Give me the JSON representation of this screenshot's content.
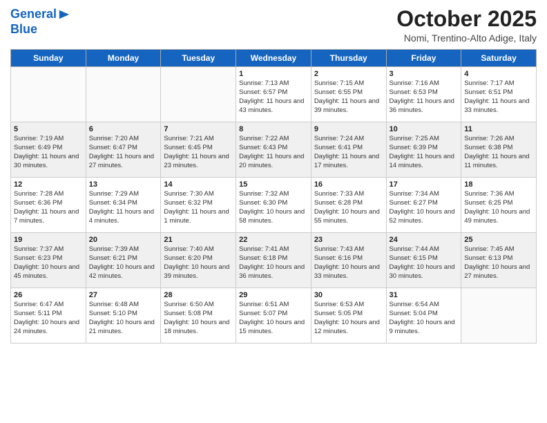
{
  "header": {
    "logo_line1": "General",
    "logo_line2": "Blue",
    "month": "October 2025",
    "location": "Nomi, Trentino-Alto Adige, Italy"
  },
  "days_of_week": [
    "Sunday",
    "Monday",
    "Tuesday",
    "Wednesday",
    "Thursday",
    "Friday",
    "Saturday"
  ],
  "weeks": [
    [
      {
        "day": "",
        "sunrise": "",
        "sunset": "",
        "daylight": ""
      },
      {
        "day": "",
        "sunrise": "",
        "sunset": "",
        "daylight": ""
      },
      {
        "day": "",
        "sunrise": "",
        "sunset": "",
        "daylight": ""
      },
      {
        "day": "1",
        "sunrise": "Sunrise: 7:13 AM",
        "sunset": "Sunset: 6:57 PM",
        "daylight": "Daylight: 11 hours and 43 minutes."
      },
      {
        "day": "2",
        "sunrise": "Sunrise: 7:15 AM",
        "sunset": "Sunset: 6:55 PM",
        "daylight": "Daylight: 11 hours and 39 minutes."
      },
      {
        "day": "3",
        "sunrise": "Sunrise: 7:16 AM",
        "sunset": "Sunset: 6:53 PM",
        "daylight": "Daylight: 11 hours and 36 minutes."
      },
      {
        "day": "4",
        "sunrise": "Sunrise: 7:17 AM",
        "sunset": "Sunset: 6:51 PM",
        "daylight": "Daylight: 11 hours and 33 minutes."
      }
    ],
    [
      {
        "day": "5",
        "sunrise": "Sunrise: 7:19 AM",
        "sunset": "Sunset: 6:49 PM",
        "daylight": "Daylight: 11 hours and 30 minutes."
      },
      {
        "day": "6",
        "sunrise": "Sunrise: 7:20 AM",
        "sunset": "Sunset: 6:47 PM",
        "daylight": "Daylight: 11 hours and 27 minutes."
      },
      {
        "day": "7",
        "sunrise": "Sunrise: 7:21 AM",
        "sunset": "Sunset: 6:45 PM",
        "daylight": "Daylight: 11 hours and 23 minutes."
      },
      {
        "day": "8",
        "sunrise": "Sunrise: 7:22 AM",
        "sunset": "Sunset: 6:43 PM",
        "daylight": "Daylight: 11 hours and 20 minutes."
      },
      {
        "day": "9",
        "sunrise": "Sunrise: 7:24 AM",
        "sunset": "Sunset: 6:41 PM",
        "daylight": "Daylight: 11 hours and 17 minutes."
      },
      {
        "day": "10",
        "sunrise": "Sunrise: 7:25 AM",
        "sunset": "Sunset: 6:39 PM",
        "daylight": "Daylight: 11 hours and 14 minutes."
      },
      {
        "day": "11",
        "sunrise": "Sunrise: 7:26 AM",
        "sunset": "Sunset: 6:38 PM",
        "daylight": "Daylight: 11 hours and 11 minutes."
      }
    ],
    [
      {
        "day": "12",
        "sunrise": "Sunrise: 7:28 AM",
        "sunset": "Sunset: 6:36 PM",
        "daylight": "Daylight: 11 hours and 7 minutes."
      },
      {
        "day": "13",
        "sunrise": "Sunrise: 7:29 AM",
        "sunset": "Sunset: 6:34 PM",
        "daylight": "Daylight: 11 hours and 4 minutes."
      },
      {
        "day": "14",
        "sunrise": "Sunrise: 7:30 AM",
        "sunset": "Sunset: 6:32 PM",
        "daylight": "Daylight: 11 hours and 1 minute."
      },
      {
        "day": "15",
        "sunrise": "Sunrise: 7:32 AM",
        "sunset": "Sunset: 6:30 PM",
        "daylight": "Daylight: 10 hours and 58 minutes."
      },
      {
        "day": "16",
        "sunrise": "Sunrise: 7:33 AM",
        "sunset": "Sunset: 6:28 PM",
        "daylight": "Daylight: 10 hours and 55 minutes."
      },
      {
        "day": "17",
        "sunrise": "Sunrise: 7:34 AM",
        "sunset": "Sunset: 6:27 PM",
        "daylight": "Daylight: 10 hours and 52 minutes."
      },
      {
        "day": "18",
        "sunrise": "Sunrise: 7:36 AM",
        "sunset": "Sunset: 6:25 PM",
        "daylight": "Daylight: 10 hours and 49 minutes."
      }
    ],
    [
      {
        "day": "19",
        "sunrise": "Sunrise: 7:37 AM",
        "sunset": "Sunset: 6:23 PM",
        "daylight": "Daylight: 10 hours and 45 minutes."
      },
      {
        "day": "20",
        "sunrise": "Sunrise: 7:39 AM",
        "sunset": "Sunset: 6:21 PM",
        "daylight": "Daylight: 10 hours and 42 minutes."
      },
      {
        "day": "21",
        "sunrise": "Sunrise: 7:40 AM",
        "sunset": "Sunset: 6:20 PM",
        "daylight": "Daylight: 10 hours and 39 minutes."
      },
      {
        "day": "22",
        "sunrise": "Sunrise: 7:41 AM",
        "sunset": "Sunset: 6:18 PM",
        "daylight": "Daylight: 10 hours and 36 minutes."
      },
      {
        "day": "23",
        "sunrise": "Sunrise: 7:43 AM",
        "sunset": "Sunset: 6:16 PM",
        "daylight": "Daylight: 10 hours and 33 minutes."
      },
      {
        "day": "24",
        "sunrise": "Sunrise: 7:44 AM",
        "sunset": "Sunset: 6:15 PM",
        "daylight": "Daylight: 10 hours and 30 minutes."
      },
      {
        "day": "25",
        "sunrise": "Sunrise: 7:45 AM",
        "sunset": "Sunset: 6:13 PM",
        "daylight": "Daylight: 10 hours and 27 minutes."
      }
    ],
    [
      {
        "day": "26",
        "sunrise": "Sunrise: 6:47 AM",
        "sunset": "Sunset: 5:11 PM",
        "daylight": "Daylight: 10 hours and 24 minutes."
      },
      {
        "day": "27",
        "sunrise": "Sunrise: 6:48 AM",
        "sunset": "Sunset: 5:10 PM",
        "daylight": "Daylight: 10 hours and 21 minutes."
      },
      {
        "day": "28",
        "sunrise": "Sunrise: 6:50 AM",
        "sunset": "Sunset: 5:08 PM",
        "daylight": "Daylight: 10 hours and 18 minutes."
      },
      {
        "day": "29",
        "sunrise": "Sunrise: 6:51 AM",
        "sunset": "Sunset: 5:07 PM",
        "daylight": "Daylight: 10 hours and 15 minutes."
      },
      {
        "day": "30",
        "sunrise": "Sunrise: 6:53 AM",
        "sunset": "Sunset: 5:05 PM",
        "daylight": "Daylight: 10 hours and 12 minutes."
      },
      {
        "day": "31",
        "sunrise": "Sunrise: 6:54 AM",
        "sunset": "Sunset: 5:04 PM",
        "daylight": "Daylight: 10 hours and 9 minutes."
      },
      {
        "day": "",
        "sunrise": "",
        "sunset": "",
        "daylight": ""
      }
    ]
  ]
}
